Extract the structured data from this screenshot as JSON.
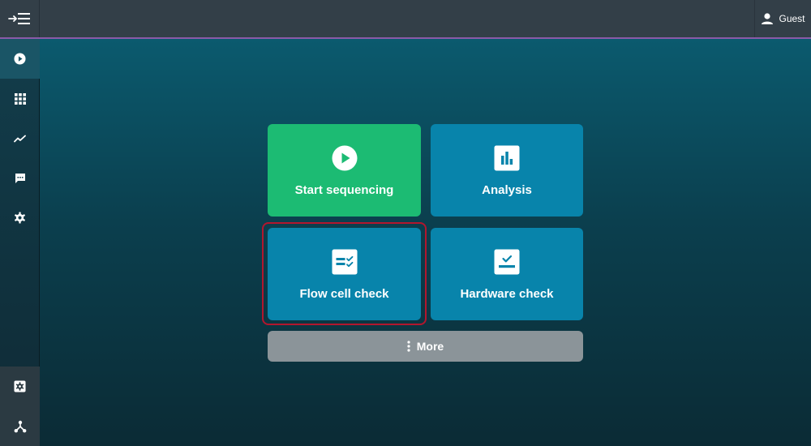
{
  "header": {
    "menu_icon": "menu-collapse-icon",
    "user_label": "Guest"
  },
  "sidebar": {
    "items": [
      {
        "name": "sequencing",
        "icon": "play-circle-icon",
        "active": true
      },
      {
        "name": "apps",
        "icon": "grid-icon"
      },
      {
        "name": "trends",
        "icon": "trend-line-icon"
      },
      {
        "name": "messages",
        "icon": "chat-icon"
      },
      {
        "name": "settings",
        "icon": "gear-icon"
      }
    ],
    "bottom_items": [
      {
        "name": "device-settings",
        "icon": "gear-box-icon"
      },
      {
        "name": "network",
        "icon": "network-icon"
      }
    ]
  },
  "tiles": {
    "start_sequencing": "Start sequencing",
    "analysis": "Analysis",
    "flow_cell_check": "Flow cell check",
    "hardware_check": "Hardware check"
  },
  "more_label": "More",
  "colors": {
    "accent_green": "#1cbb73",
    "tile_blue": "#0884ab",
    "focus_red": "#b3162d",
    "header_underline": "#8a5aa8"
  }
}
